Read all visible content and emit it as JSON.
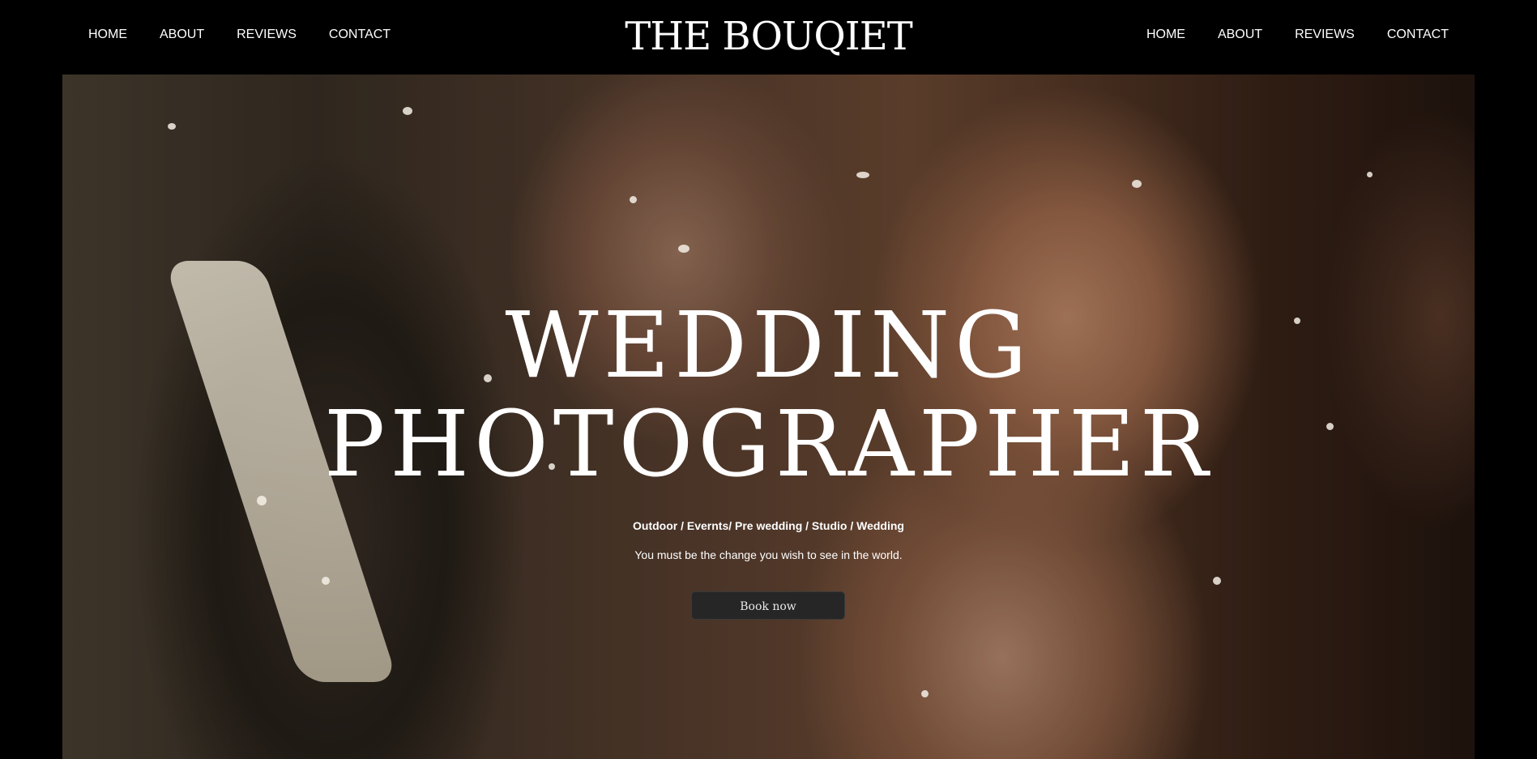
{
  "header": {
    "brand": "THE BOUQIET",
    "nav_left": [
      {
        "label": "HOME"
      },
      {
        "label": "ABOUT"
      },
      {
        "label": "REVIEWS"
      },
      {
        "label": "CONTACT"
      }
    ],
    "nav_right": [
      {
        "label": "HOME"
      },
      {
        "label": "ABOUT"
      },
      {
        "label": "REVIEWS"
      },
      {
        "label": "CONTACT"
      }
    ]
  },
  "hero": {
    "title_line1": "WEDDING",
    "title_line2": "PHOTOGRAPHER",
    "categories": "Outdoor / Evernts/ Pre wedding / Studio / Wedding",
    "quote": "You must be the change you wish to see in the world.",
    "cta_label": "Book now"
  },
  "colors": {
    "background": "#000000",
    "text": "#ffffff",
    "button_bg": "#262626"
  }
}
